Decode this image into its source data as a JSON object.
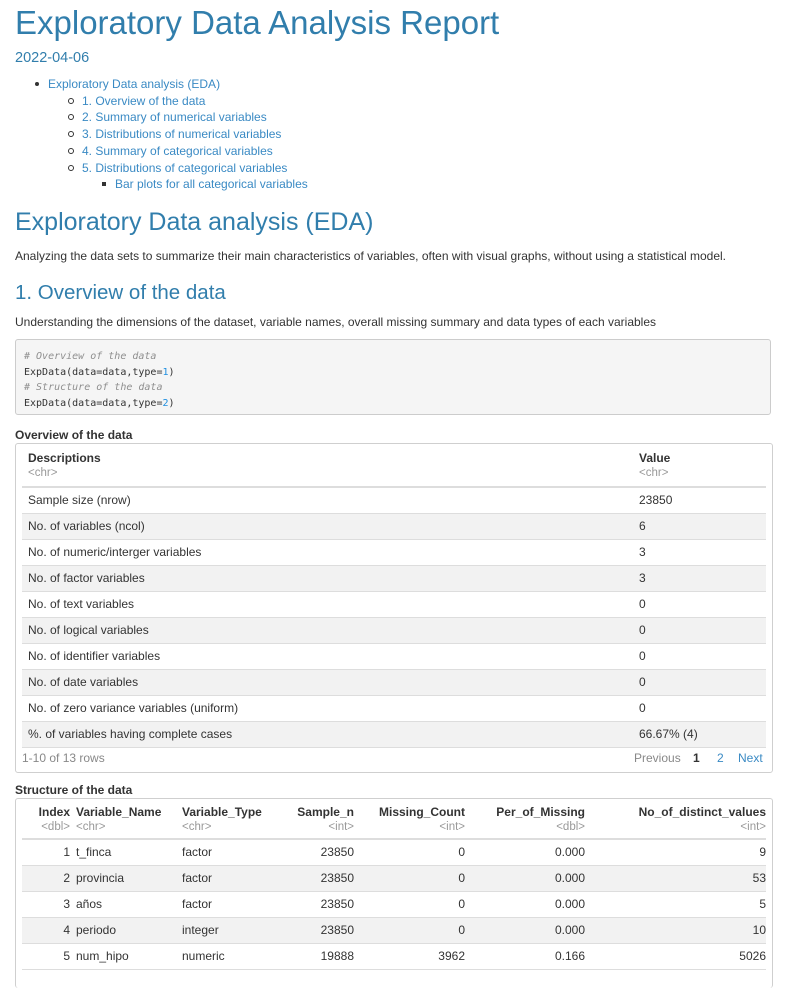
{
  "header": {
    "title": "Exploratory Data Analysis Report",
    "date": "2022-04-06"
  },
  "toc": {
    "items": [
      {
        "label": "Exploratory Data analysis (EDA)",
        "level": 1
      },
      {
        "label": "1. Overview of the data",
        "level": 2
      },
      {
        "label": "2. Summary of numerical variables",
        "level": 2
      },
      {
        "label": "3. Distributions of numerical variables",
        "level": 2
      },
      {
        "label": "4. Summary of categorical variables",
        "level": 2
      },
      {
        "label": "5. Distributions of categorical variables",
        "level": 2
      },
      {
        "label": "Bar plots for all categorical variables",
        "level": 3
      }
    ]
  },
  "eda": {
    "heading": "Exploratory Data analysis (EDA)",
    "description": "Analyzing the data sets to summarize their main characteristics of variables, often with visual graphs, without using a statistical model."
  },
  "overview": {
    "heading": "1. Overview of the data",
    "description": "Understanding the dimensions of the dataset, variable names, overall missing summary and data types of each variables",
    "code": {
      "comment1": "# Overview of the data",
      "line1_fn": "ExpData(data=data,type=",
      "line1_num": "1",
      "line1_end": ")",
      "comment2": "# Structure of the data",
      "line2_fn": "ExpData(data=data,type=",
      "line2_num": "2",
      "line2_end": ")"
    }
  },
  "overview_table": {
    "caption": "Overview of the data",
    "columns": [
      {
        "name": "Descriptions",
        "type": "<chr>"
      },
      {
        "name": "Value",
        "type": "<chr>"
      }
    ],
    "rows": [
      [
        "Sample size (nrow)",
        "23850"
      ],
      [
        "No. of variables (ncol)",
        "6"
      ],
      [
        "No. of numeric/interger variables",
        "3"
      ],
      [
        "No. of factor variables",
        "3"
      ],
      [
        "No. of text variables",
        "0"
      ],
      [
        "No. of logical variables",
        "0"
      ],
      [
        "No. of identifier variables",
        "0"
      ],
      [
        "No. of date variables",
        "0"
      ],
      [
        "No. of zero variance variables (uniform)",
        "0"
      ],
      [
        "%. of variables having complete cases",
        "66.67% (4)"
      ]
    ],
    "pager": {
      "info": "1-10 of 13 rows",
      "previous": "Previous",
      "page1": "1",
      "page2": "2",
      "next": "Next"
    }
  },
  "structure_table": {
    "caption": "Structure of the data",
    "columns": [
      {
        "name": "Index",
        "type": "<dbl>"
      },
      {
        "name": "Variable_Name",
        "type": "<chr>"
      },
      {
        "name": "Variable_Type",
        "type": "<chr>"
      },
      {
        "name": "Sample_n",
        "type": "<int>"
      },
      {
        "name": "Missing_Count",
        "type": "<int>"
      },
      {
        "name": "Per_of_Missing",
        "type": "<dbl>"
      },
      {
        "name": "No_of_distinct_values",
        "type": "<int>"
      }
    ],
    "rows": [
      [
        "1",
        "t_finca",
        "factor",
        "23850",
        "0",
        "0.000",
        "9"
      ],
      [
        "2",
        "provincia",
        "factor",
        "23850",
        "0",
        "0.000",
        "53"
      ],
      [
        "3",
        "años",
        "factor",
        "23850",
        "0",
        "0.000",
        "5"
      ],
      [
        "4",
        "periodo",
        "integer",
        "23850",
        "0",
        "0.000",
        "10"
      ],
      [
        "5",
        "num_hipo",
        "numeric",
        "19888",
        "3962",
        "0.166",
        "5026"
      ]
    ]
  }
}
